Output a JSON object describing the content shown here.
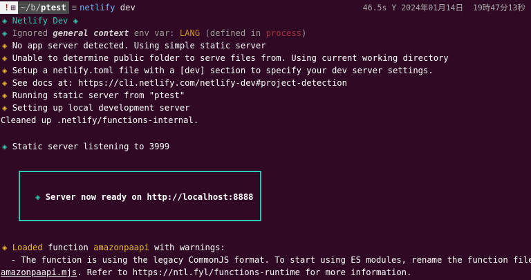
{
  "prompt": {
    "alert_glyph": "!",
    "os_glyph": "⊞",
    "path_prefix": "~/b/",
    "path_dir": "ptest",
    "separator": "≡",
    "command": "netlify",
    "command_arg": "dev",
    "duration": "46.5s",
    "status_glyph": "Y",
    "datetime": "2024年01月14日  19時47分13秒"
  },
  "lines": {
    "l1": {
      "diamond": "◈",
      "text": "Netlify Dev",
      "diamond2": "◈"
    },
    "l2": {
      "diamond": "◈",
      "pre": "Ignored ",
      "context": "general context",
      "mid": " env var: ",
      "var": "LANG",
      "post": " (defined in ",
      "source": "process",
      "end": ")"
    },
    "l3": {
      "diamond": "◈",
      "text": "No app server detected. Using simple static server"
    },
    "l4": {
      "diamond": "◈",
      "text": "Unable to determine public folder to serve files from. Using current working directory"
    },
    "l5": {
      "diamond": "◈",
      "text": "Setup a netlify.toml file with a [dev] section to specify your dev server settings."
    },
    "l6": {
      "diamond": "◈",
      "text": "See docs at: https://cli.netlify.com/netlify-dev#project-detection"
    },
    "l7": {
      "diamond": "◈",
      "text": "Running static server from \"ptest\""
    },
    "l8": {
      "diamond": "◈",
      "text": "Setting up local development server"
    },
    "l9": {
      "text": "Cleaned up .netlify/functions-internal."
    },
    "l10": {
      "diamond": "◈",
      "text": "Static server listening to 3999"
    },
    "server_ready": {
      "diamond": "◈",
      "text": "Server now ready on http://localhost:8888"
    },
    "l11": {
      "diamond": "◈",
      "loaded": "Loaded",
      "mid": " function ",
      "fn_name": "amazonpaapi",
      "post": " with warnings:"
    },
    "l12": {
      "text": "  - The function is using the legacy CommonJS format. To start using ES modules, rename the function file to"
    },
    "l13": {
      "file": "amazonpaapi.mjs",
      "text": ". Refer to https://ntl.fyl/functions-runtime for more information."
    }
  },
  "colors": {
    "background": "#300a24",
    "accent_teal": "#2ec7b0",
    "warning_yellow": "#e8b62c",
    "command_blue": "#6fb8f5"
  }
}
